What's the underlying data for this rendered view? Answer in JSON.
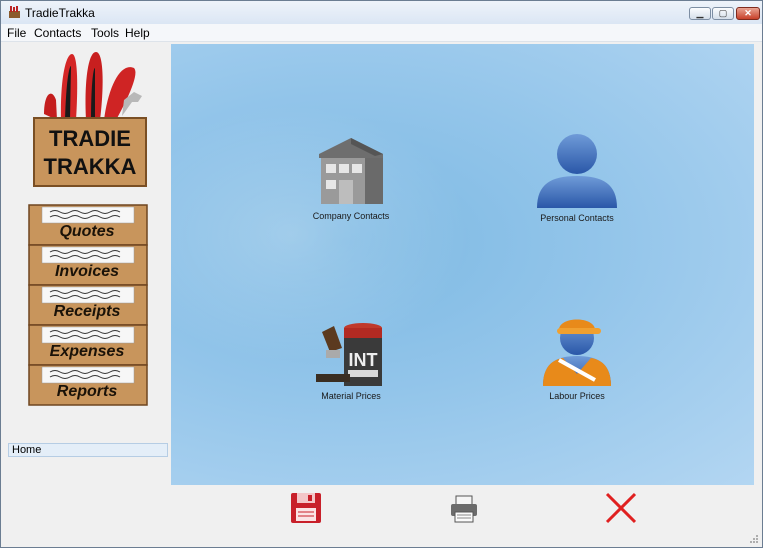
{
  "window": {
    "title": "TradieTrakka",
    "minimize_label": "▁",
    "maximize_label": "▢",
    "close_label": "✕"
  },
  "menu": [
    "File",
    "Contacts",
    "Tools",
    "Help"
  ],
  "logo": {
    "line1": "TRADIE",
    "line2": "TRAKKA"
  },
  "drawers": [
    "Quotes",
    "Invoices",
    "Receipts",
    "Expenses",
    "Reports"
  ],
  "breadcrumb": "Home",
  "tiles": {
    "company_contacts": "Company Contacts",
    "personal_contacts": "Personal Contacts",
    "material_prices": "Material Prices",
    "labour_prices": "Labour Prices"
  },
  "toolbar": {
    "save_icon": "save-icon",
    "print_icon": "print-icon",
    "close_icon": "close-icon"
  },
  "colors": {
    "background": "#8cc2e8",
    "drawer_wood": "#c8955c",
    "close_red": "#e02020",
    "save_red": "#c8202a"
  }
}
